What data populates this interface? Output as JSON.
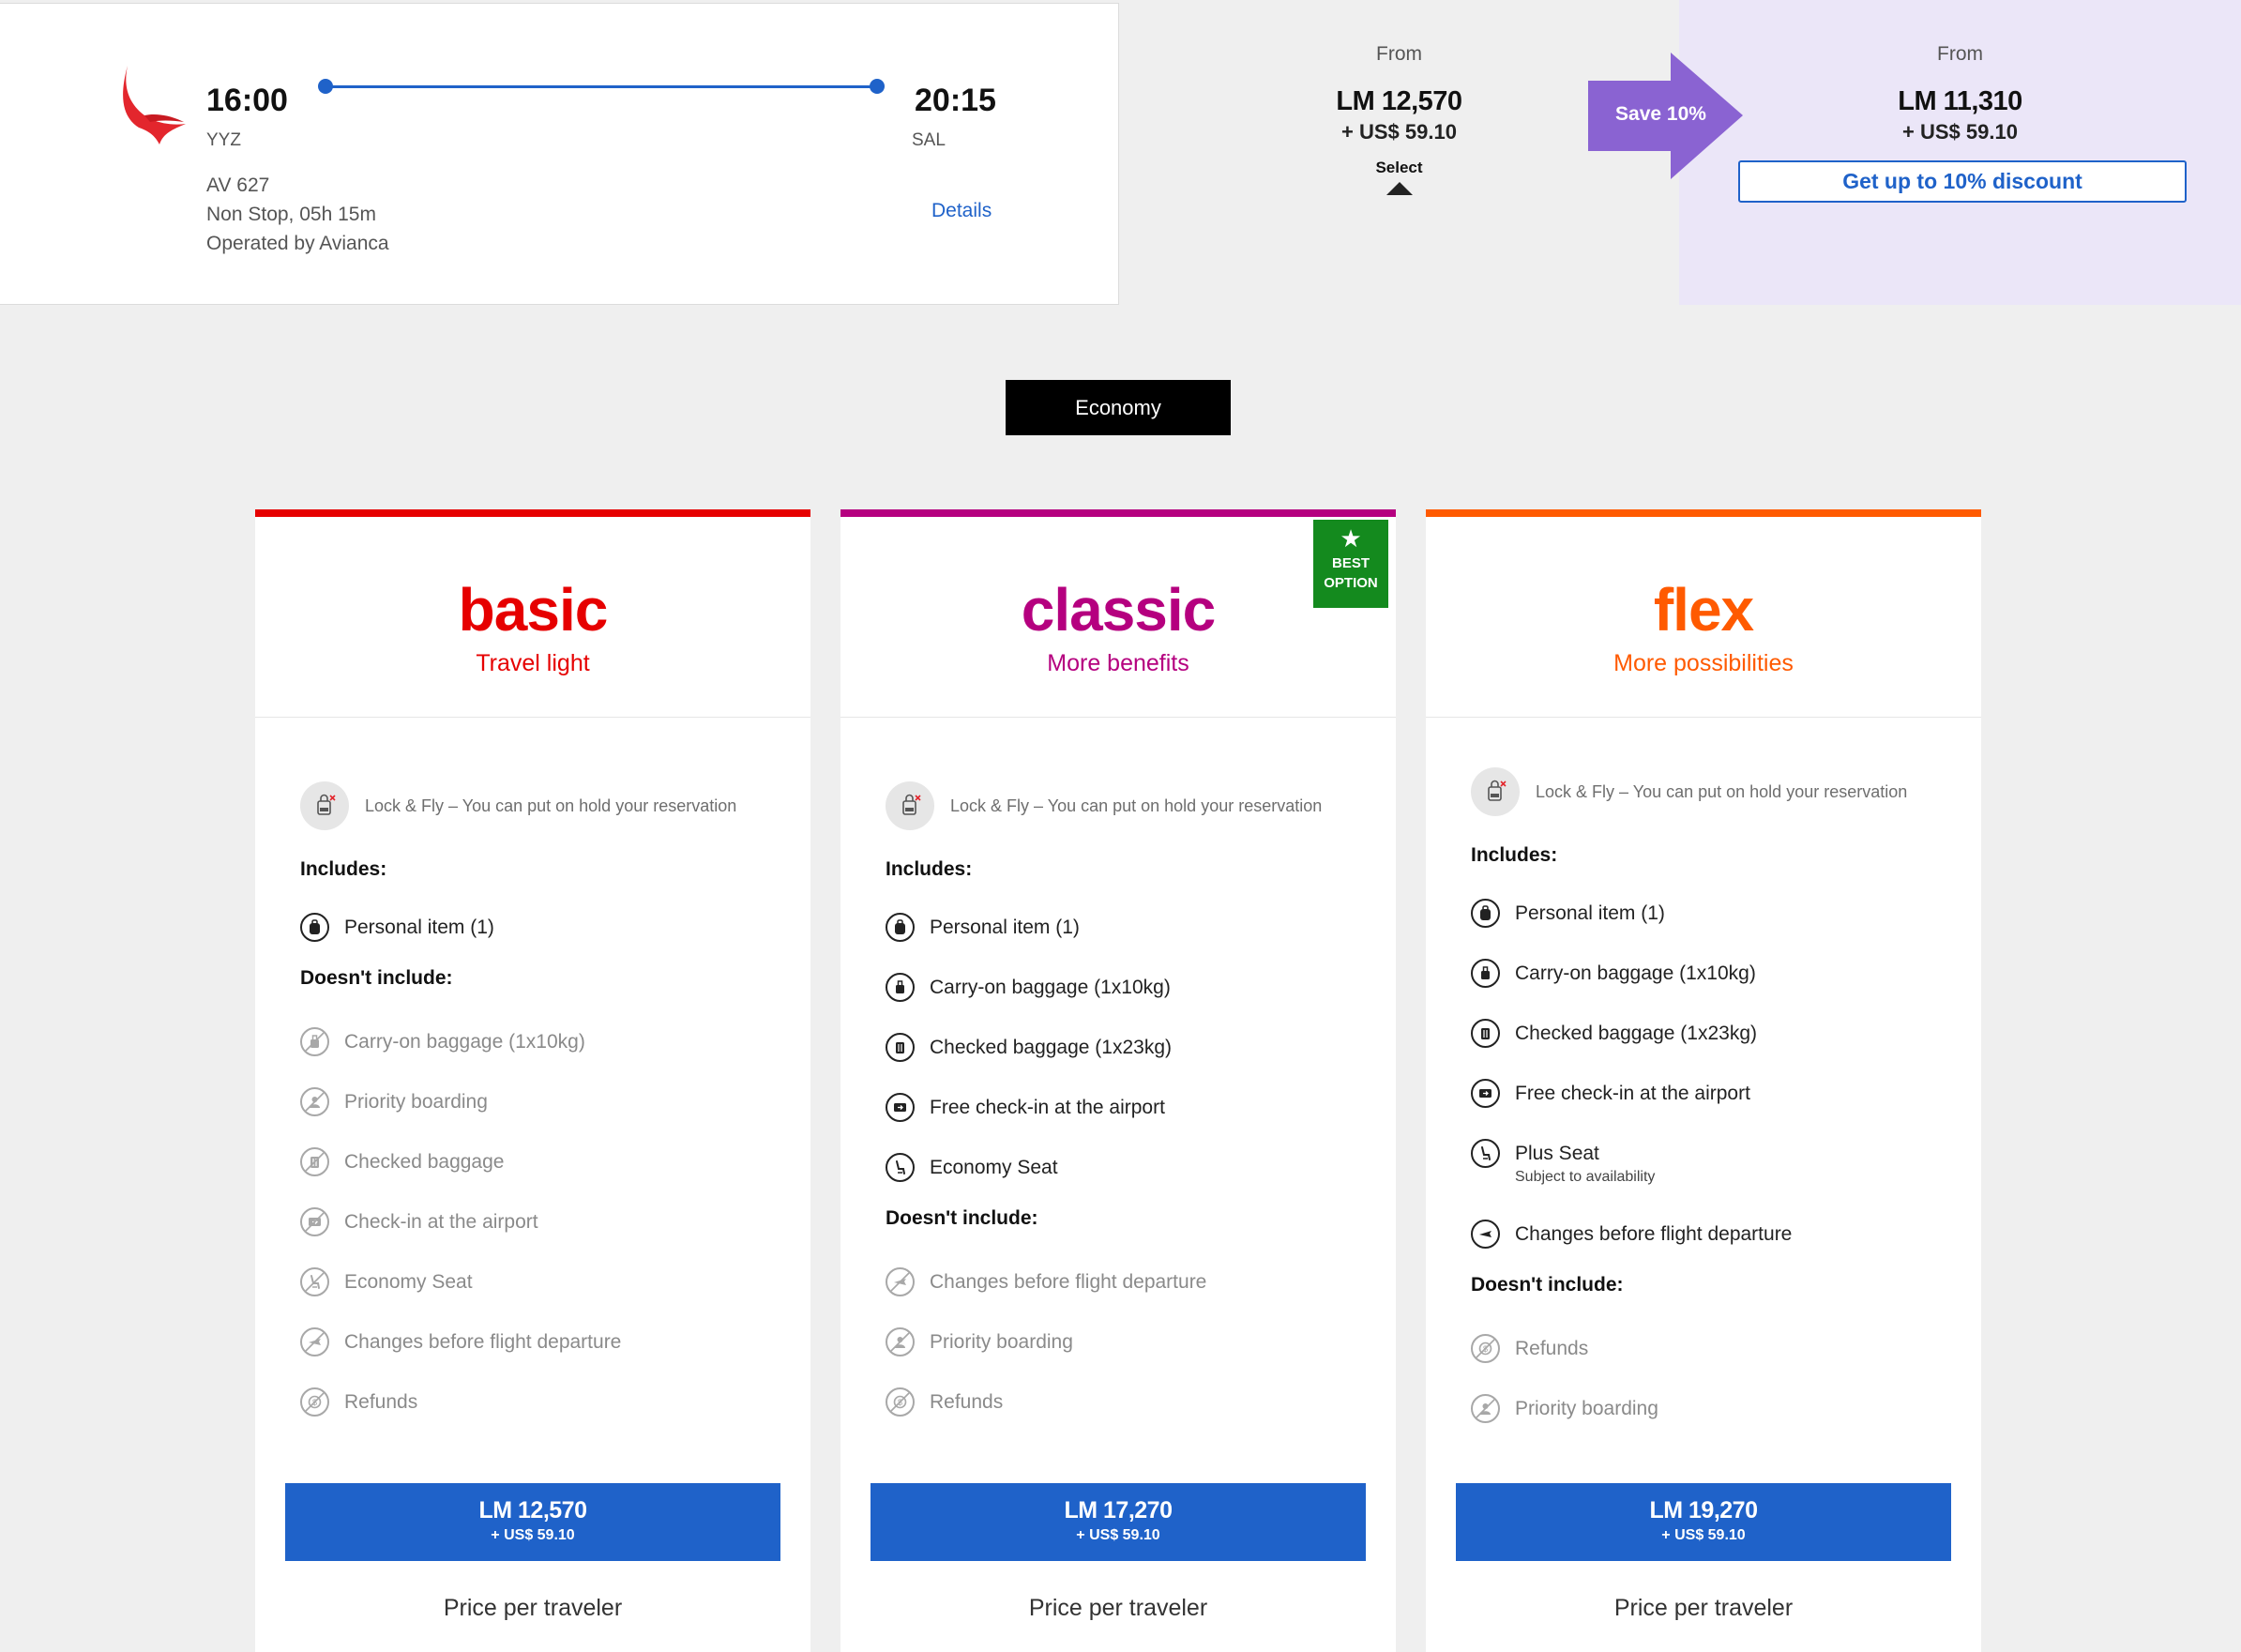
{
  "flight": {
    "departure_time": "16:00",
    "departure_code": "YYZ",
    "arrival_time": "20:15",
    "arrival_code": "SAL",
    "flight_number": "AV 627",
    "duration": "Non Stop, 05h 15m",
    "operator": "Operated by Avianca",
    "details_label": "Details",
    "logo_icon": "avianca-bird-logo"
  },
  "prices": {
    "standard": {
      "from_label": "From",
      "lm": "LM 12,570",
      "usd": "+ US$ 59.10",
      "select_label": "Select"
    },
    "discount": {
      "from_label": "From",
      "lm": "LM 11,310",
      "usd": "+ US$ 59.10",
      "badge": "Save 10%",
      "button_label": "Get up to 10% discount"
    }
  },
  "cabin_tab": "Economy",
  "fares": [
    {
      "name": "basic",
      "tagline": "Travel light",
      "color": "#e60000",
      "lock_fly": "Lock & Fly – You can put on hold your reservation",
      "includes_title": "Includes:",
      "includes": [
        {
          "label": "Personal item (1)",
          "icon": "backpack-icon"
        }
      ],
      "excludes_title": "Doesn't include:",
      "excludes": [
        {
          "label": "Carry-on baggage (1x10kg)",
          "icon": "carry-on-icon"
        },
        {
          "label": "Priority boarding",
          "icon": "priority-icon"
        },
        {
          "label": "Checked baggage",
          "icon": "checked-bag-icon"
        },
        {
          "label": "Check-in at the airport",
          "icon": "ticket-icon"
        },
        {
          "label": "Economy Seat",
          "icon": "seat-icon"
        },
        {
          "label": "Changes before flight departure",
          "icon": "plane-change-icon"
        },
        {
          "label": "Refunds",
          "icon": "refund-icon"
        }
      ],
      "price_lm": "LM 12,570",
      "price_usd": "+ US$ 59.10",
      "price_note": "Price per traveler"
    },
    {
      "name": "classic",
      "tagline": "More benefits",
      "color": "#b5007f",
      "badge_line1": "BEST",
      "badge_line2": "OPTION",
      "lock_fly": "Lock & Fly – You can put on hold your reservation",
      "includes_title": "Includes:",
      "includes": [
        {
          "label": "Personal item (1)",
          "icon": "backpack-icon"
        },
        {
          "label": "Carry-on baggage (1x10kg)",
          "icon": "carry-on-icon"
        },
        {
          "label": "Checked baggage (1x23kg)",
          "icon": "checked-bag-icon"
        },
        {
          "label": "Free check-in at the airport",
          "icon": "ticket-icon"
        },
        {
          "label": "Economy Seat",
          "icon": "seat-icon"
        }
      ],
      "excludes_title": "Doesn't include:",
      "excludes": [
        {
          "label": "Changes before flight departure",
          "icon": "plane-change-icon"
        },
        {
          "label": "Priority boarding",
          "icon": "priority-icon"
        },
        {
          "label": "Refunds",
          "icon": "refund-icon"
        }
      ],
      "price_lm": "LM 17,270",
      "price_usd": "+ US$ 59.10",
      "price_note": "Price per traveler"
    },
    {
      "name": "flex",
      "tagline": "More possibilities",
      "color": "#ff5a00",
      "lock_fly": "Lock & Fly – You can put on hold your reservation",
      "includes_title": "Includes:",
      "includes": [
        {
          "label": "Personal item (1)",
          "icon": "backpack-icon"
        },
        {
          "label": "Carry-on baggage (1x10kg)",
          "icon": "carry-on-icon"
        },
        {
          "label": "Checked baggage (1x23kg)",
          "icon": "checked-bag-icon"
        },
        {
          "label": "Free check-in at the airport",
          "icon": "ticket-icon"
        },
        {
          "label": "Plus Seat",
          "sub": "Subject to availability",
          "icon": "seat-icon"
        },
        {
          "label": "Changes before flight departure",
          "icon": "plane-change-icon"
        }
      ],
      "excludes_title": "Doesn't include:",
      "excludes": [
        {
          "label": "Refunds",
          "icon": "refund-icon"
        },
        {
          "label": "Priority boarding",
          "icon": "priority-icon"
        }
      ],
      "price_lm": "LM 19,270",
      "price_usd": "+ US$ 59.10",
      "price_note": "Price per traveler"
    }
  ],
  "colors": {
    "accent_blue": "#1f62c9",
    "discount_purple": "#8a63d2",
    "best_green": "#148a1e"
  }
}
